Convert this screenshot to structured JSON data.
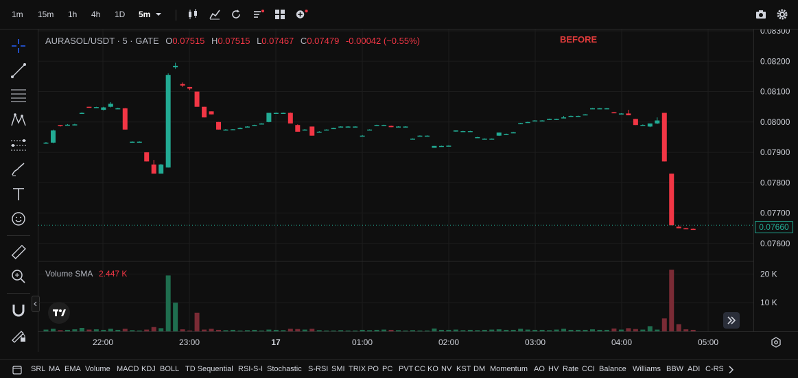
{
  "toolbar": {
    "timeframes": [
      "1m",
      "15m",
      "1h",
      "4h",
      "1D"
    ],
    "active_timeframe": "5m",
    "icons": [
      "candlestick-type-icon",
      "indicators-icon",
      "replay-icon",
      "templates-icon",
      "layouts-icon",
      "add-alert-icon",
      "camera-icon",
      "settings-icon"
    ]
  },
  "legend": {
    "symbol": "AURASOL/USDT · 5 · GATE",
    "o_label": "O",
    "o": "0.07515",
    "h_label": "H",
    "h": "0.07515",
    "l_label": "L",
    "l": "0.07467",
    "c_label": "C",
    "c": "0.07479",
    "change": "-0.00042 (−0.55%)"
  },
  "annotation": "BEFORE",
  "volume_legend": {
    "label": "Volume SMA",
    "value": "2.447 K"
  },
  "last_price": "0.07660",
  "colors": {
    "up": "#22ab94",
    "down": "#f23645",
    "up_vol": "#1f6e4f",
    "down_vol": "#7a2b35",
    "annotation": "#e23b3b"
  },
  "chart_data": {
    "type": "candlestick",
    "title": "AURASOL/USDT · 5 · GATE",
    "price_axis_ticks": [
      "0.08300",
      "0.08200",
      "0.08100",
      "0.08000",
      "0.07900",
      "0.07800",
      "0.07700",
      "0.07600"
    ],
    "volume_axis_ticks": [
      "20 K",
      "10 K"
    ],
    "time_axis_ticks": [
      "22:00",
      "23:00",
      "17",
      "01:00",
      "02:00",
      "03:00",
      "04:00",
      "05:00"
    ],
    "ylim": [
      0.0755,
      0.083
    ],
    "volume_ylim": [
      0,
      22000
    ],
    "candles": [
      [
        0.0793,
        0.07934,
        0.07928,
        0.07932,
        600
      ],
      [
        0.07932,
        0.07975,
        0.0793,
        0.07972,
        900
      ],
      [
        0.0799,
        0.0799,
        0.07985,
        0.07988,
        400
      ],
      [
        0.0799,
        0.07993,
        0.07988,
        0.07991,
        500
      ],
      [
        0.07991,
        0.07994,
        0.07989,
        0.07992,
        700
      ],
      [
        0.0803,
        0.08032,
        0.08028,
        0.0803,
        1200
      ],
      [
        0.0805,
        0.0805,
        0.08047,
        0.08048,
        600
      ],
      [
        0.08048,
        0.0805,
        0.08046,
        0.08049,
        700
      ],
      [
        0.0804,
        0.0805,
        0.08038,
        0.08048,
        500
      ],
      [
        0.0805,
        0.08065,
        0.08048,
        0.0806,
        900
      ],
      [
        0.08045,
        0.08047,
        0.08043,
        0.08045,
        500
      ],
      [
        0.08045,
        0.08046,
        0.07975,
        0.07975,
        900
      ],
      [
        0.07935,
        0.07936,
        0.07933,
        0.07935,
        400
      ],
      [
        0.07935,
        0.07936,
        0.07933,
        0.07935,
        300
      ],
      [
        0.079,
        0.079,
        0.0787,
        0.0787,
        600
      ],
      [
        0.0786,
        0.07875,
        0.0783,
        0.0783,
        1500
      ],
      [
        0.0783,
        0.07862,
        0.0783,
        0.0786,
        1100
      ],
      [
        0.0785,
        0.0816,
        0.0785,
        0.08155,
        19500
      ],
      [
        0.0818,
        0.08195,
        0.08175,
        0.08185,
        10000
      ],
      [
        0.08125,
        0.0813,
        0.08115,
        0.0812,
        700
      ],
      [
        0.08115,
        0.08115,
        0.08105,
        0.0811,
        300
      ],
      [
        0.081,
        0.081,
        0.0805,
        0.0805,
        6500
      ],
      [
        0.0805,
        0.0805,
        0.08015,
        0.08015,
        600
      ],
      [
        0.08035,
        0.08035,
        0.08025,
        0.08025,
        900
      ],
      [
        0.08,
        0.08,
        0.07975,
        0.07975,
        500
      ],
      [
        0.07975,
        0.07977,
        0.07973,
        0.07975,
        400
      ],
      [
        0.07975,
        0.07977,
        0.07974,
        0.07976,
        500
      ],
      [
        0.0798,
        0.07982,
        0.07978,
        0.0798,
        300
      ],
      [
        0.07985,
        0.07986,
        0.07983,
        0.07985,
        400
      ],
      [
        0.0799,
        0.07991,
        0.07988,
        0.0799,
        500
      ],
      [
        0.07995,
        0.07996,
        0.07993,
        0.07995,
        300
      ],
      [
        0.08,
        0.0803,
        0.07999,
        0.0803,
        600
      ],
      [
        0.0803,
        0.08031,
        0.08029,
        0.0803,
        500
      ],
      [
        0.0803,
        0.08031,
        0.08029,
        0.0803,
        400
      ],
      [
        0.0803,
        0.08031,
        0.07995,
        0.07995,
        900
      ],
      [
        0.0799,
        0.07992,
        0.07968,
        0.07968,
        800
      ],
      [
        0.07975,
        0.07977,
        0.07973,
        0.07975,
        600
      ],
      [
        0.07985,
        0.07985,
        0.07955,
        0.07955,
        900
      ],
      [
        0.07968,
        0.0797,
        0.07966,
        0.07968,
        400
      ],
      [
        0.07975,
        0.07976,
        0.07974,
        0.07975,
        300
      ],
      [
        0.0798,
        0.07981,
        0.07979,
        0.0798,
        300
      ],
      [
        0.07985,
        0.07986,
        0.07984,
        0.07985,
        400
      ],
      [
        0.07985,
        0.07986,
        0.07984,
        0.07985,
        300
      ],
      [
        0.07985,
        0.07986,
        0.07984,
        0.07985,
        300
      ],
      [
        0.07955,
        0.07957,
        0.07953,
        0.07955,
        500
      ],
      [
        0.07975,
        0.07976,
        0.07974,
        0.07975,
        400
      ],
      [
        0.0799,
        0.07991,
        0.07989,
        0.0799,
        500
      ],
      [
        0.0799,
        0.07991,
        0.07988,
        0.0799,
        600
      ],
      [
        0.07987,
        0.07988,
        0.07983,
        0.07983,
        500
      ],
      [
        0.07985,
        0.07986,
        0.07984,
        0.07985,
        400
      ],
      [
        0.07985,
        0.07986,
        0.07984,
        0.07985,
        300
      ],
      [
        0.07945,
        0.07946,
        0.07944,
        0.07945,
        400
      ],
      [
        0.07955,
        0.07956,
        0.07954,
        0.07955,
        300
      ],
      [
        0.07955,
        0.07956,
        0.07954,
        0.07955,
        300
      ],
      [
        0.07915,
        0.07921,
        0.07915,
        0.07921,
        1000
      ],
      [
        0.07921,
        0.07922,
        0.0792,
        0.07921,
        500
      ],
      [
        0.07922,
        0.07923,
        0.07921,
        0.07922,
        500
      ],
      [
        0.0797,
        0.07972,
        0.07968,
        0.07972,
        600
      ],
      [
        0.0797,
        0.07971,
        0.07969,
        0.0797,
        400
      ],
      [
        0.0797,
        0.07971,
        0.07969,
        0.0797,
        500
      ],
      [
        0.0795,
        0.07951,
        0.07949,
        0.0795,
        400
      ],
      [
        0.07945,
        0.07946,
        0.07944,
        0.07945,
        500
      ],
      [
        0.07945,
        0.07946,
        0.07944,
        0.07945,
        600
      ],
      [
        0.07955,
        0.07965,
        0.07954,
        0.07965,
        700
      ],
      [
        0.0796,
        0.07962,
        0.07959,
        0.0796,
        500
      ],
      [
        0.07965,
        0.07967,
        0.07964,
        0.07966,
        500
      ],
      [
        0.07995,
        0.07997,
        0.07994,
        0.07996,
        900
      ],
      [
        0.08,
        0.08001,
        0.07999,
        0.08,
        600
      ],
      [
        0.08005,
        0.08006,
        0.08004,
        0.08005,
        500
      ],
      [
        0.08005,
        0.08006,
        0.08004,
        0.08005,
        500
      ],
      [
        0.0801,
        0.08011,
        0.08009,
        0.0801,
        400
      ],
      [
        0.0801,
        0.08011,
        0.08009,
        0.0801,
        600
      ],
      [
        0.08015,
        0.0802,
        0.08014,
        0.08015,
        900
      ],
      [
        0.0802,
        0.08021,
        0.08019,
        0.0802,
        500
      ],
      [
        0.0802,
        0.08021,
        0.08019,
        0.0802,
        500
      ],
      [
        0.08025,
        0.08026,
        0.08024,
        0.08025,
        500
      ],
      [
        0.08045,
        0.08046,
        0.08044,
        0.08045,
        700
      ],
      [
        0.08045,
        0.08046,
        0.08044,
        0.08045,
        500
      ],
      [
        0.08045,
        0.08046,
        0.08044,
        0.08045,
        500
      ],
      [
        0.08032,
        0.08033,
        0.0803,
        0.0803,
        1000
      ],
      [
        0.08028,
        0.08029,
        0.08027,
        0.08028,
        600
      ],
      [
        0.08028,
        0.0804,
        0.08022,
        0.08022,
        1100
      ],
      [
        0.0801,
        0.0801,
        0.0799,
        0.0799,
        800
      ],
      [
        0.0799,
        0.07992,
        0.07988,
        0.0799,
        600
      ],
      [
        0.07985,
        0.07995,
        0.07983,
        0.07995,
        1800
      ],
      [
        0.07995,
        0.08015,
        0.07993,
        0.08005,
        600
      ],
      [
        0.0803,
        0.0803,
        0.0787,
        0.0787,
        4500
      ],
      [
        0.0783,
        0.0783,
        0.0766,
        0.0766,
        21500
      ],
      [
        0.07655,
        0.0766,
        0.0765,
        0.0765,
        2500
      ],
      [
        0.0765,
        0.07651,
        0.07648,
        0.07648,
        700
      ],
      [
        0.07648,
        0.07649,
        0.07647,
        0.07647,
        500
      ]
    ]
  },
  "indicators": [
    "SRL",
    "MA",
    "EMA",
    "Volume",
    "MACD",
    "KDJ",
    "BOLL",
    "TD Sequential",
    "RSI-S-I",
    "Stochastic",
    "S-RSI",
    "SMI",
    "TRIX",
    "PO",
    "PC",
    "PVT",
    "CC",
    "KO",
    "NV",
    "KST",
    "DM",
    "Momentum",
    "AO",
    "HV",
    "Rate",
    "CCI",
    "Balance",
    "Williams",
    "BBW",
    "ADI",
    "C-RSI"
  ]
}
